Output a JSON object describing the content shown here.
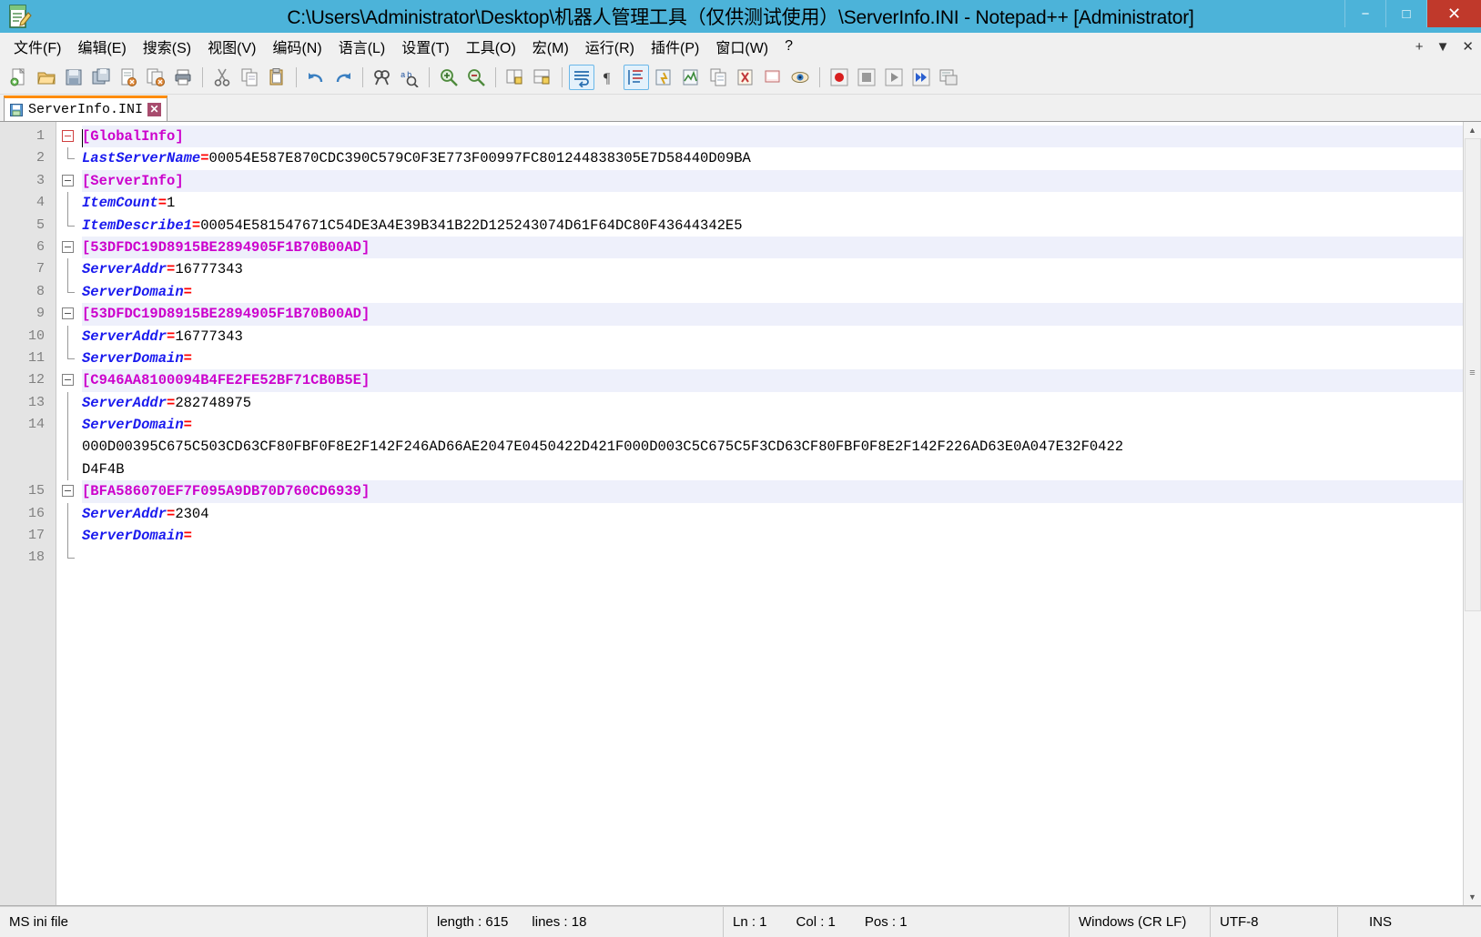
{
  "window": {
    "title": "C:\\Users\\Administrator\\Desktop\\机器人管理工具（仅供测试使用）\\ServerInfo.INI - Notepad++ [Administrator]",
    "icon": "notepad-plus-plus-icon",
    "controls": {
      "minimize": "−",
      "maximize": "□",
      "close": "✕"
    }
  },
  "menubar": {
    "items": [
      {
        "label": "文件(F)",
        "name": "menu-file"
      },
      {
        "label": "编辑(E)",
        "name": "menu-edit"
      },
      {
        "label": "搜索(S)",
        "name": "menu-search"
      },
      {
        "label": "视图(V)",
        "name": "menu-view"
      },
      {
        "label": "编码(N)",
        "name": "menu-encoding"
      },
      {
        "label": "语言(L)",
        "name": "menu-language"
      },
      {
        "label": "设置(T)",
        "name": "menu-settings"
      },
      {
        "label": "工具(O)",
        "name": "menu-tools"
      },
      {
        "label": "宏(M)",
        "name": "menu-macro"
      },
      {
        "label": "运行(R)",
        "name": "menu-run"
      },
      {
        "label": "插件(P)",
        "name": "menu-plugins"
      },
      {
        "label": "窗口(W)",
        "name": "menu-window"
      },
      {
        "label": "?",
        "name": "menu-help"
      }
    ],
    "right": {
      "plus": "+",
      "chevron": "▼",
      "close": "✕"
    }
  },
  "toolbar": {
    "buttons": [
      {
        "name": "new-file-icon",
        "glyph": "new"
      },
      {
        "name": "open-file-icon",
        "glyph": "open"
      },
      {
        "name": "save-icon",
        "glyph": "save"
      },
      {
        "name": "save-all-icon",
        "glyph": "saveall"
      },
      {
        "name": "close-file-icon",
        "glyph": "closefile"
      },
      {
        "name": "close-all-icon",
        "glyph": "closeall"
      },
      {
        "name": "print-icon",
        "glyph": "print"
      },
      {
        "name": "separator-1",
        "glyph": "sep"
      },
      {
        "name": "cut-icon",
        "glyph": "cut"
      },
      {
        "name": "copy-icon",
        "glyph": "copy"
      },
      {
        "name": "paste-icon",
        "glyph": "paste"
      },
      {
        "name": "separator-2",
        "glyph": "sep"
      },
      {
        "name": "undo-icon",
        "glyph": "undo"
      },
      {
        "name": "redo-icon",
        "glyph": "redo"
      },
      {
        "name": "separator-3",
        "glyph": "sep"
      },
      {
        "name": "find-icon",
        "glyph": "find"
      },
      {
        "name": "replace-icon",
        "glyph": "replace"
      },
      {
        "name": "separator-4",
        "glyph": "sep"
      },
      {
        "name": "zoom-in-icon",
        "glyph": "zoomin"
      },
      {
        "name": "zoom-out-icon",
        "glyph": "zoomout"
      },
      {
        "name": "separator-5",
        "glyph": "sep"
      },
      {
        "name": "sync-vertical-icon",
        "glyph": "syncv"
      },
      {
        "name": "sync-horizontal-icon",
        "glyph": "synch"
      },
      {
        "name": "separator-6",
        "glyph": "sep"
      },
      {
        "name": "word-wrap-icon",
        "glyph": "wrap",
        "active": true
      },
      {
        "name": "show-all-chars-icon",
        "glyph": "pilcrow"
      },
      {
        "name": "indent-guide-icon",
        "glyph": "indentguide",
        "active": true
      },
      {
        "name": "user-defined-dialog-icon",
        "glyph": "udl"
      },
      {
        "name": "document-map-icon",
        "glyph": "docmap"
      },
      {
        "name": "function-list-icon",
        "glyph": "funclist"
      },
      {
        "name": "folder-as-workspace-icon",
        "glyph": "workspace"
      },
      {
        "name": "monitor-icon",
        "glyph": "monitor"
      },
      {
        "name": "eye-icon",
        "glyph": "eye"
      },
      {
        "name": "separator-7",
        "glyph": "sep"
      },
      {
        "name": "macro-record-icon",
        "glyph": "record"
      },
      {
        "name": "macro-stop-icon",
        "glyph": "stop"
      },
      {
        "name": "macro-play-icon",
        "glyph": "play"
      },
      {
        "name": "macro-playmany-icon",
        "glyph": "playmany"
      },
      {
        "name": "macro-save-icon",
        "glyph": "macrosave"
      }
    ]
  },
  "tabs": [
    {
      "label": "ServerInfo.INI",
      "close": "✕",
      "active": true
    }
  ],
  "editor": {
    "line_numbers": [
      "1",
      "2",
      "3",
      "4",
      "5",
      "6",
      "7",
      "8",
      "9",
      "10",
      "11",
      "12",
      "13",
      "14",
      "15",
      "16",
      "17",
      "18"
    ],
    "lines": [
      {
        "num": 1,
        "type": "section",
        "text": "[GlobalInfo]",
        "fold": "open-red"
      },
      {
        "num": 2,
        "type": "kv",
        "key": "LastServerName",
        "value": "00054E587E870CDC390C579C0F3E773F00997FC801244838305E7D58440D09BA",
        "fold": "end"
      },
      {
        "num": 3,
        "type": "section",
        "text": "[ServerInfo]",
        "fold": "open"
      },
      {
        "num": 4,
        "type": "kv",
        "key": "ItemCount",
        "value": "1",
        "fold": "line"
      },
      {
        "num": 5,
        "type": "kv",
        "key": "ItemDescribe1",
        "value": "00054E581547671C54DE3A4E39B341B22D125243074D61F64DC80F43644342E5",
        "fold": "end"
      },
      {
        "num": 6,
        "type": "section",
        "text": "[53DFDC19D8915BE2894905F1B70B00AD]",
        "fold": "open"
      },
      {
        "num": 7,
        "type": "kv",
        "key": "ServerAddr",
        "value": "16777343",
        "fold": "line"
      },
      {
        "num": 8,
        "type": "kv",
        "key": "ServerDomain",
        "value": "",
        "fold": "end"
      },
      {
        "num": 9,
        "type": "section",
        "text": "[53DFDC19D8915BE2894905F1B70B00AD]",
        "fold": "open"
      },
      {
        "num": 10,
        "type": "kv",
        "key": "ServerAddr",
        "value": "16777343",
        "fold": "line"
      },
      {
        "num": 11,
        "type": "kv",
        "key": "ServerDomain",
        "value": "",
        "fold": "end"
      },
      {
        "num": 12,
        "type": "section",
        "text": "[C946AA8100094B4FE2FE52BF71CB0B5E]",
        "fold": "open"
      },
      {
        "num": 13,
        "type": "kv",
        "key": "ServerAddr",
        "value": "282748975",
        "fold": "line"
      },
      {
        "num": 14,
        "type": "kv",
        "key": "ServerDomain",
        "value": "",
        "fold": "line",
        "wrap": [
          "000D00395C675C503CD63CF80FBF0F8E2F142F246AD66AE2047E0450422D421F000D003C5C675C5F3CD63CF80FBF0F8E2F142F226AD63E0A047E32F0422",
          "D4F4B"
        ]
      },
      {
        "num": 15,
        "type": "section",
        "text": "[BFA586070EF7F095A9DB70D760CD6939]",
        "fold": "open"
      },
      {
        "num": 16,
        "type": "kv",
        "key": "ServerAddr",
        "value": "2304",
        "fold": "line"
      },
      {
        "num": 17,
        "type": "kv",
        "key": "ServerDomain",
        "value": "",
        "fold": "line"
      },
      {
        "num": 18,
        "type": "blank",
        "text": "",
        "fold": "end"
      }
    ],
    "colors": {
      "section": "#cc00cc",
      "key": "#1a1aee",
      "equals": "#ff0000",
      "value": "#000000",
      "section_line_bg": "#eef0fb",
      "gutter_bg": "#e4e4e4",
      "gutter_fg": "#808080"
    }
  },
  "scrollbar": {
    "up_arrow": "▲",
    "down_arrow": "▼",
    "grip": "≡"
  },
  "statusbar": {
    "doc_type": "MS ini file",
    "length_label": "length : 615",
    "lines_label": "lines : 18",
    "ln": "Ln : 1",
    "col": "Col : 1",
    "pos": "Pos : 1",
    "eol": "Windows (CR LF)",
    "encoding": "UTF-8",
    "mode": "INS"
  }
}
